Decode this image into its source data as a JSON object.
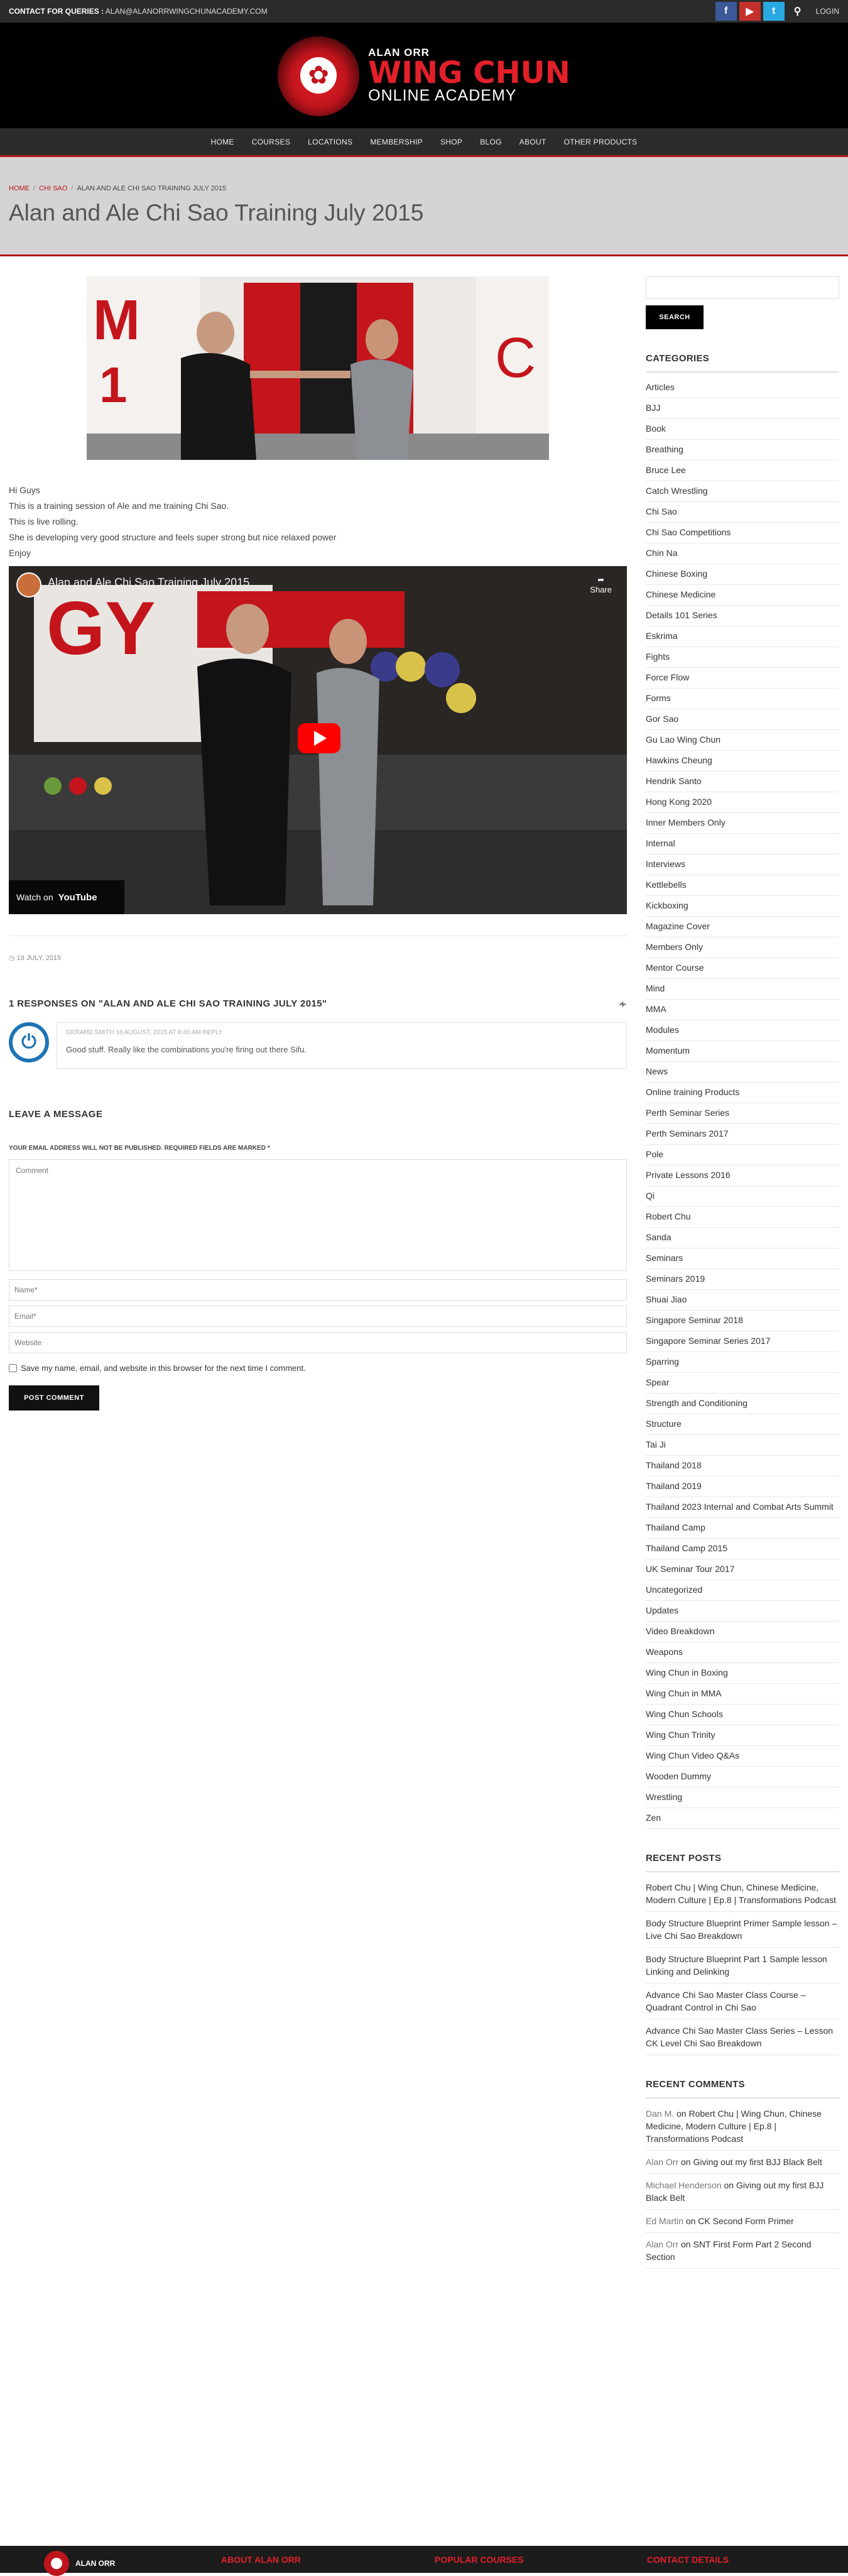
{
  "topbar": {
    "contact_label": "CONTACT FOR QUERIES :",
    "contact_email": "ALAN@ALANORRWINGCHUNACADEMY.COM",
    "facebook": "f",
    "youtube": "▶",
    "twitter": "t",
    "login": "LOGIN"
  },
  "logo": {
    "line1": "ALAN ORR",
    "line2": "WING CHUN",
    "line3": "ONLINE ACADEMY"
  },
  "nav": [
    "HOME",
    "COURSES",
    "LOCATIONS",
    "MEMBERSHIP",
    "SHOP",
    "BLOG",
    "ABOUT",
    "OTHER PRODUCTS"
  ],
  "breadcrumb": {
    "home": "HOME",
    "cat": "CHI SAO",
    "current": "ALAN AND ALE CHI SAO TRAINING JULY 2015"
  },
  "page_title": "Alan and Ale Chi Sao Training July 2015",
  "post": {
    "paragraphs": [
      "Hi Guys",
      "This is a training session of Ale and me training Chi Sao.",
      "This is live rolling.",
      "She is developing very good structure and feels super strong but nice relaxed power",
      "Enjoy"
    ],
    "video_title": "Alan and Ale Chi Sao Training July 2015",
    "video_share": "Share",
    "video_watch": "Watch on",
    "video_brand": "YouTube",
    "date": "19 JULY, 2015"
  },
  "responses_title": "1 RESPONSES ON \"ALAN AND ALE CHI SAO TRAINING JULY 2015\"",
  "comment": {
    "author": "GERARD SMITH",
    "date": "16 AUGUST, 2015 AT 8:46 AM",
    "reply": "REPLY",
    "text": "Good stuff. Really like the combinations you're firing out there Sifu."
  },
  "form": {
    "heading": "LEAVE A MESSAGE",
    "note": "YOUR EMAIL ADDRESS WILL NOT BE PUBLISHED. REQUIRED FIELDS ARE MARKED *",
    "comment_ph": "Comment",
    "name_ph": "Name*",
    "email_ph": "Email*",
    "website_ph": "Website",
    "save_label": "Save my name, email, and website in this browser for the next time I comment.",
    "submit": "POST COMMENT"
  },
  "sidebar": {
    "search_button": "SEARCH",
    "categories_title": "CATEGORIES",
    "categories": [
      "Articles",
      "BJJ",
      "Book",
      "Breathing",
      "Bruce Lee",
      "Catch Wrestling",
      "Chi Sao",
      "Chi Sao Competitions",
      "Chin Na",
      "Chinese Boxing",
      "Chinese Medicine",
      "Details 101 Series",
      "Eskrima",
      "Fights",
      "Force Flow",
      "Forms",
      "Gor Sao",
      "Gu Lao Wing Chun",
      "Hawkins Cheung",
      "Hendrik Santo",
      "Hong Kong 2020",
      "Inner Members Only",
      "Internal",
      "Interviews",
      "Kettlebells",
      "Kickboxing",
      "Magazine Cover",
      "Members Only",
      "Mentor Course",
      "Mind",
      "MMA",
      "Modules",
      "Momentum",
      "News",
      "Online training Products",
      "Perth Seminar Series",
      "Perth Seminars 2017",
      "Pole",
      "Private Lessons 2016",
      "Qi",
      "Robert Chu",
      "Sanda",
      "Seminars",
      "Seminars 2019",
      "Shuai Jiao",
      "Singapore Seminar 2018",
      "Singapore Seminar Series 2017",
      "Sparring",
      "Spear",
      "Strength and Conditioning",
      "Structure",
      "Tai Ji",
      "Thailand 2018",
      "Thailand 2019",
      "Thailand 2023 Internal and Combat Arts Summit",
      "Thailand Camp",
      "Thailand Camp 2015",
      "UK Seminar Tour 2017",
      "Uncategorized",
      "Updates",
      "Video Breakdown",
      "Weapons",
      "Wing Chun in Boxing",
      "Wing Chun in MMA",
      "Wing Chun Schools",
      "Wing Chun Trinity",
      "Wing Chun Video Q&As",
      "Wooden Dummy",
      "Wrestling",
      "Zen"
    ],
    "recent_posts_title": "RECENT POSTS",
    "recent_posts": [
      "Robert Chu | Wing Chun, Chinese Medicine, Modern Culture | Ep.8 | Transformations Podcast",
      "Body Structure Blueprint Primer Sample lesson – Live Chi Sao Breakdown",
      "Body Structure Blueprint Part 1 Sample lesson Linking and Delinking",
      "Advance Chi Sao Master Class Course – Quadrant Control in Chi Sao",
      "Advance Chi Sao Master Class Series – Lesson CK Level Chi Sao Breakdown"
    ],
    "recent_comments_title": "RECENT COMMENTS",
    "recent_comments": [
      {
        "author": "Dan M.",
        "on": "on",
        "post": "Robert Chu | Wing Chun, Chinese Medicine, Modern Culture | Ep.8 | Transformations Podcast"
      },
      {
        "author": "Alan Orr",
        "on": "on",
        "post": "Giving out my first BJJ Black Belt"
      },
      {
        "author": "Michael Henderson",
        "on": "on",
        "post": "Giving out my first BJJ Black Belt"
      },
      {
        "author": "Ed Martin",
        "on": "on",
        "post": "CK Second Form Primer"
      },
      {
        "author": "Alan Orr",
        "on": "on",
        "post": "SNT First Form Part 2 Second Section"
      }
    ]
  },
  "footer": {
    "logo_text": "ALAN ORR",
    "col1": "ABOUT ALAN ORR",
    "col2": "POPULAR COURSES",
    "col3": "CONTACT DETAILS"
  }
}
